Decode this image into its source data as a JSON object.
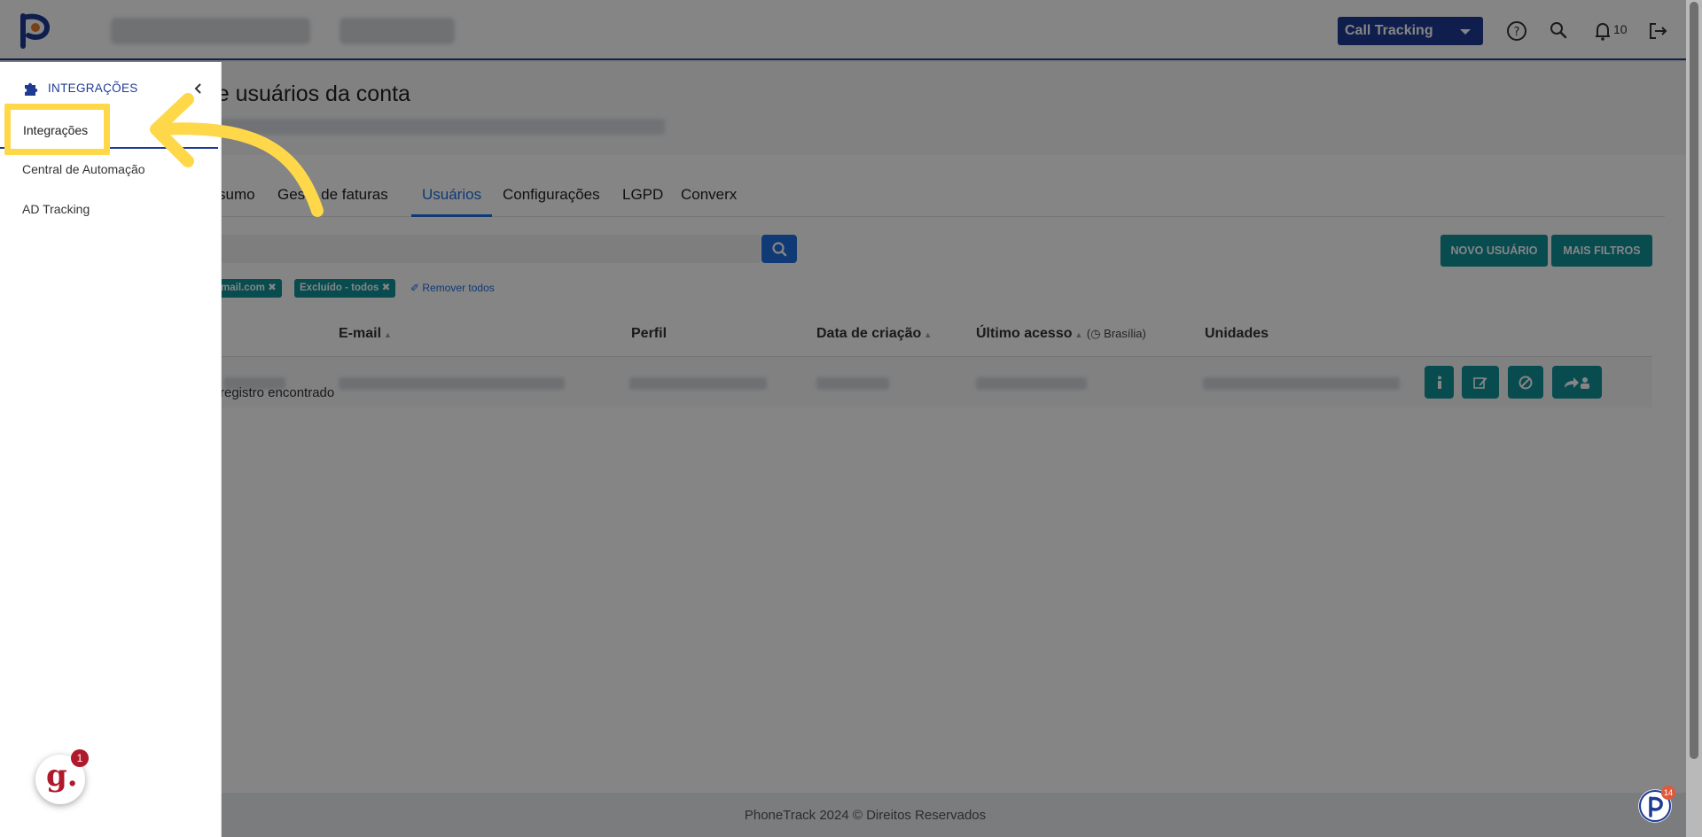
{
  "header": {
    "product_select": "Call Tracking",
    "notification_count": "10"
  },
  "page": {
    "title": "o de usuários da conta"
  },
  "tabs": [
    {
      "label": "sumo"
    },
    {
      "label": "Gesʼo de faturas"
    },
    {
      "label": "Usuários"
    },
    {
      "label": "Configurações"
    },
    {
      "label": "LGPD"
    },
    {
      "label": "Converx"
    }
  ],
  "filters": {
    "chips": [
      "gmail.com ✖",
      "Excluído - todos ✖"
    ],
    "remove_all": "Remover todos"
  },
  "buttons": {
    "new_user": "NOVO USUÁRIO",
    "more_filters": "MAIS FILTROS"
  },
  "table": {
    "headers": {
      "email": "E-mail",
      "profile": "Perfil",
      "created": "Data de criação",
      "last_access": "Último acesso",
      "timezone": "Brasília",
      "units": "Unidades"
    },
    "empty_message": "registro encontrado"
  },
  "footer": {
    "text": "PhoneTrack 2024 © Direitos Reservados"
  },
  "sidebar": {
    "section_label": "INTEGRAÇÕES",
    "items": [
      {
        "label": "Integrações"
      },
      {
        "label": "Central de Automação"
      },
      {
        "label": "AD Tracking"
      }
    ]
  },
  "widgets": {
    "gchat_badge": "1",
    "pt_badge": "14"
  },
  "colors": {
    "brand_blue": "#1d3b92",
    "accent_blue": "#1d6fe0",
    "teal": "#11939a",
    "highlight_yellow": "#ffd84a"
  }
}
